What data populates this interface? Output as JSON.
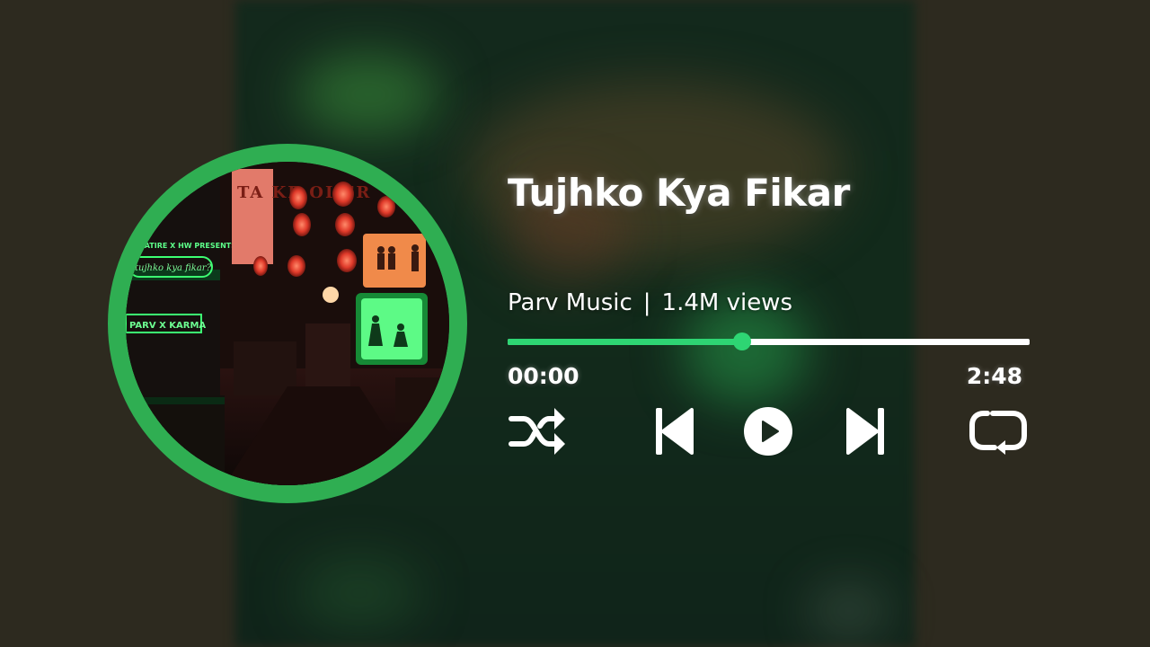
{
  "track": {
    "title": "Tujhko Kya Fikar",
    "artist": "Parv Music",
    "separator": "|",
    "views": "1.4M views"
  },
  "album_art": {
    "neon_credits": "X SATIRE X HW PRESENTS",
    "neon_title": "tujhko kya fikar?",
    "neon_artists": "PARV X KARMA",
    "sign_text": "TA KE OI ER"
  },
  "player": {
    "current_time": "00:00",
    "total_time": "2:48",
    "progress_fraction": 0.449,
    "state": "paused"
  },
  "controls": {
    "shuffle_icon": "shuffle-icon",
    "previous_icon": "skip-previous-icon",
    "play_icon": "play-icon",
    "next_icon": "skip-next-icon",
    "repeat_icon": "repeat-icon"
  },
  "colors": {
    "accent": "#2ed573",
    "ring": "#2fae52",
    "background": "#2d2a1f",
    "text": "#ffffff"
  }
}
